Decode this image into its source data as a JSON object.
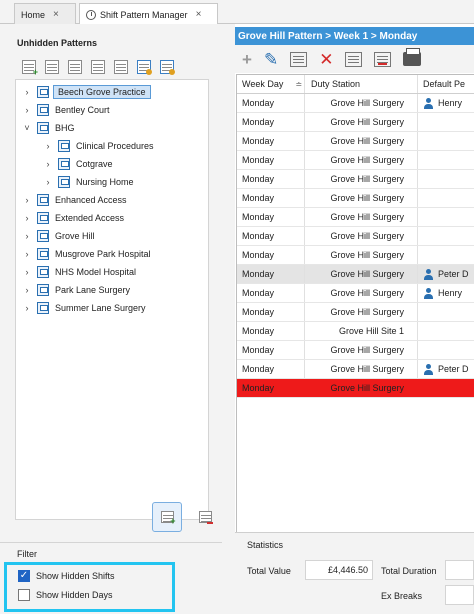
{
  "tabs": [
    {
      "label": "Home",
      "close": "×"
    },
    {
      "label": "Shift Pattern Manager",
      "close": "×"
    }
  ],
  "left": {
    "title": "Unhidden Patterns",
    "toolbar_icons": [
      "add-pattern-icon",
      "edit-pattern-icon",
      "delete-pattern-icon",
      "copy-pattern-icon",
      "hide-pattern-icon",
      "calendar-add-icon",
      "calendar-check-icon"
    ],
    "tree": [
      {
        "label": "Beech Grove Practice",
        "chevron": "›",
        "selected": true
      },
      {
        "label": "Bentley Court",
        "chevron": "›"
      },
      {
        "label": "BHG",
        "chevron": "˅"
      },
      {
        "label": "Clinical Procedures",
        "chevron": "›"
      },
      {
        "label": "Cotgrave",
        "chevron": "›"
      },
      {
        "label": "Nursing Home",
        "chevron": "›"
      },
      {
        "label": "Enhanced Access",
        "chevron": "›"
      },
      {
        "label": "Extended Access",
        "chevron": "›"
      },
      {
        "label": "Grove Hill",
        "chevron": "›"
      },
      {
        "label": "Musgrove Park Hospital",
        "chevron": "›"
      },
      {
        "label": "NHS Model Hospital",
        "chevron": "›"
      },
      {
        "label": "Park Lane Surgery",
        "chevron": "›"
      },
      {
        "label": "Summer Lane Surgery",
        "chevron": "›"
      }
    ]
  },
  "filter": {
    "title": "Filter",
    "show_hidden_shifts": {
      "label": "Show Hidden Shifts",
      "checked": true,
      "mark": "✓"
    },
    "show_hidden_days": {
      "label": "Show Hidden Days",
      "checked": false
    }
  },
  "right": {
    "header": "Grove Hill Pattern > Week 1 > Monday",
    "toolbar": {
      "add": "+",
      "edit": "✎",
      "delete": "✕"
    },
    "columns": [
      "Week Day",
      "Duty Station",
      "Default Pe"
    ],
    "sort_glyph": "≐",
    "rows": [
      {
        "day": "Monday",
        "station": "Grove Hill Surgery",
        "person": "Henry"
      },
      {
        "day": "Monday",
        "station": "Grove Hill Surgery",
        "person": ""
      },
      {
        "day": "Monday",
        "station": "Grove Hill Surgery",
        "person": ""
      },
      {
        "day": "Monday",
        "station": "Grove Hill Surgery",
        "person": ""
      },
      {
        "day": "Monday",
        "station": "Grove Hill Surgery",
        "person": ""
      },
      {
        "day": "Monday",
        "station": "Grove Hill Surgery",
        "person": ""
      },
      {
        "day": "Monday",
        "station": "Grove Hill Surgery",
        "person": ""
      },
      {
        "day": "Monday",
        "station": "Grove Hill Surgery",
        "person": ""
      },
      {
        "day": "Monday",
        "station": "Grove Hill Surgery",
        "person": ""
      },
      {
        "day": "Monday",
        "station": "Grove Hill Surgery",
        "person": "Peter D",
        "state": "gray"
      },
      {
        "day": "Monday",
        "station": "Grove Hill Surgery",
        "person": "Henry"
      },
      {
        "day": "Monday",
        "station": "Grove Hill Surgery",
        "person": ""
      },
      {
        "day": "Monday",
        "station": "Grove Hill Site 1",
        "person": ""
      },
      {
        "day": "Monday",
        "station": "Grove Hill Surgery",
        "person": ""
      },
      {
        "day": "Monday",
        "station": "Grove Hill Surgery",
        "person": "Peter D"
      },
      {
        "day": "Monday",
        "station": "Grove Hill Surgery",
        "person": "",
        "state": "red"
      }
    ]
  },
  "stats": {
    "title": "Statistics",
    "total_value_label": "Total Value",
    "total_value": "£4,446.50",
    "total_duration_label": "Total Duration",
    "ex_breaks_label": "Ex Breaks"
  },
  "colors": {
    "header_blue": "#3c93d6",
    "selected_row_red": "#ee1a1a",
    "highlight_box": "#22c4f0"
  }
}
